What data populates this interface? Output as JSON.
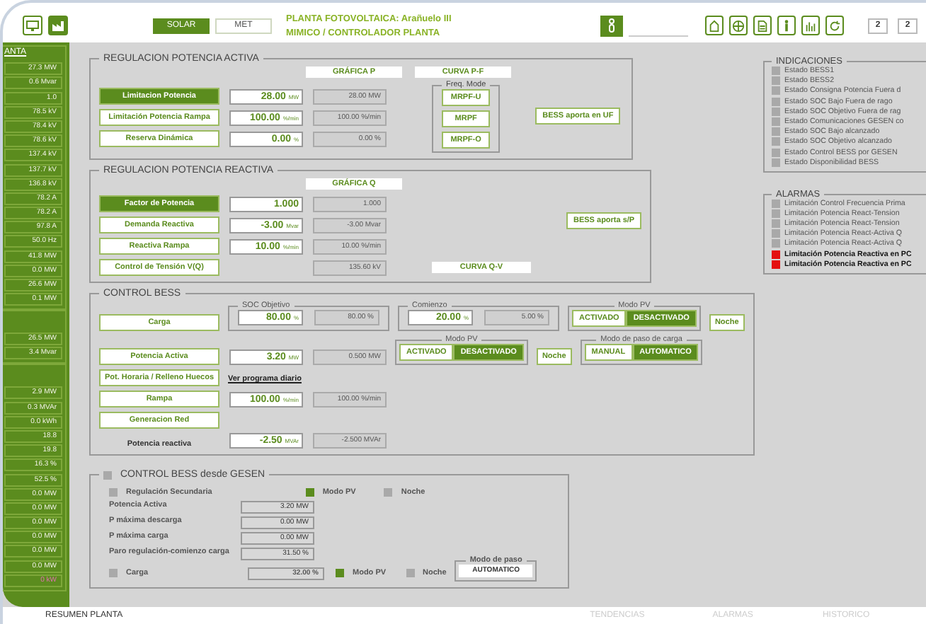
{
  "header": {
    "modes": [
      {
        "label": "SOLAR",
        "selected": true
      },
      {
        "label": "MET",
        "selected": false
      }
    ],
    "title": "PLANTA FOTOVOLTAICA:  Arañuelo III",
    "breadcrumb": "MIMICO / CONTROLADOR PLANTA",
    "counters": [
      "2",
      "2"
    ]
  },
  "sidebar": {
    "sections": [
      {
        "title": "ANTA",
        "items": [
          {
            "value": "27.3 MW",
            "alarm": false
          },
          {
            "value": "0.6 Mvar",
            "alarm": false
          },
          {
            "value": "1.0",
            "alarm": false
          },
          {
            "value": "78.5 kV",
            "alarm": false
          },
          {
            "value": "78.4 kV",
            "alarm": false
          },
          {
            "value": "78.6 kV",
            "alarm": false
          },
          {
            "value": "137.4 kV",
            "alarm": false
          },
          {
            "value": "137.7 kV",
            "alarm": false
          },
          {
            "value": "136.8 kV",
            "alarm": false
          },
          {
            "value": "78.2 A",
            "alarm": false
          },
          {
            "value": "78.2 A",
            "alarm": false
          },
          {
            "value": "97.8 A",
            "alarm": false
          },
          {
            "value": "50.0 Hz",
            "alarm": false
          },
          {
            "value": "41.8 MW",
            "alarm": false
          },
          {
            "value": "0.0 MW",
            "alarm": false
          },
          {
            "value": "26.6 MW",
            "alarm": false
          },
          {
            "value": "0.1 MW",
            "alarm": false
          }
        ]
      },
      {
        "items": [
          {
            "value": "26.5 MW",
            "alarm": false
          },
          {
            "value": "3.4 Mvar",
            "alarm": false
          }
        ]
      },
      {
        "items": [
          {
            "value": "2.9 MW",
            "alarm": false
          },
          {
            "value": "0.3 MVAr",
            "alarm": false
          },
          {
            "value": "0.0 kWh",
            "alarm": false
          },
          {
            "value": "18.8",
            "alarm": false
          },
          {
            "value": "19.8",
            "alarm": false
          },
          {
            "value": "16.3 %",
            "alarm": false
          },
          {
            "value": "52.5 %",
            "alarm": false
          },
          {
            "value": "0.0 MW",
            "alarm": false
          },
          {
            "value": "0.0 MW",
            "alarm": false
          },
          {
            "value": "0.0 MW",
            "alarm": false
          },
          {
            "value": "0.0 MW",
            "alarm": false
          },
          {
            "value": "0.0 MW",
            "alarm": false
          },
          {
            "value": "0.0 MW",
            "alarm": false
          },
          {
            "value": "0 kW",
            "alarm": true
          }
        ]
      }
    ]
  },
  "active_power": {
    "title": "REGULACION POTENCIA ACTIVA",
    "charts": [
      "GRÁFICA P",
      "CURVA P-F"
    ],
    "rows": [
      {
        "label": "Limitacion Potencia",
        "selected": true,
        "setpoint": "28.00",
        "unit": "MW",
        "actual": "28.00 MW"
      },
      {
        "label": "Limitación Potencia Rampa",
        "selected": false,
        "setpoint": "100.00",
        "unit": "%/min",
        "actual": "100.00 %/min"
      },
      {
        "label": "Reserva Dinámica",
        "selected": false,
        "setpoint": "0.00",
        "unit": "%",
        "actual": "0.00 %"
      }
    ],
    "freq_mode": {
      "title": "Freq. Mode",
      "buttons": [
        "MRPF-U",
        "MRPF",
        "MRPF-O"
      ]
    },
    "bess": "BESS aporta en UF"
  },
  "reactive_power": {
    "title": "REGULACION POTENCIA REACTIVA",
    "charts": [
      "GRÁFICA Q"
    ],
    "rows": [
      {
        "label": "Factor de Potencia",
        "selected": true,
        "setpoint": "1.000",
        "unit": "",
        "actual": "1.000"
      },
      {
        "label": "Demanda Reactiva",
        "selected": false,
        "setpoint": "-3.00",
        "unit": "Mvar",
        "actual": "-3.00 Mvar"
      },
      {
        "label": "Reactiva Rampa",
        "selected": false,
        "setpoint": "10.00",
        "unit": "%/min",
        "actual": "10.00 %/min"
      },
      {
        "label": "Control de Tensión V(Q)",
        "selected": false,
        "actual": "135.60 kV"
      }
    ],
    "bess": "BESS aporta s/P",
    "curve": "CURVA Q-V"
  },
  "control_bess": {
    "title": "CONTROL BESS",
    "lines": [
      [
        {
          "kind": "button",
          "label": "Carga",
          "selected": false
        },
        {
          "kind": "group",
          "title": "SOC Objetivo",
          "setpoint": "80.00",
          "unit": "%",
          "actual": "80.00 %"
        },
        {
          "kind": "group",
          "title": "Comienzo",
          "setpoint": "20.00",
          "unit": "%",
          "actual": "5.00 %"
        },
        {
          "kind": "toggle",
          "title": "Modo PV",
          "options": [
            {
              "label": "ACTIVADO",
              "selected": false
            },
            {
              "label": "DESACTIVADO",
              "selected": true
            }
          ]
        },
        {
          "kind": "button",
          "label": "Noche",
          "selected": false
        }
      ],
      [
        {
          "kind": "button",
          "label": "Potencia Activa",
          "selected": false
        },
        {
          "kind": "fields",
          "setpoint": "3.20",
          "unit": "MW",
          "actual": "0.500 MW"
        },
        {
          "kind": "toggle",
          "title": "Modo PV",
          "options": [
            {
              "label": "ACTIVADO",
              "selected": false
            },
            {
              "label": "DESACTIVADO",
              "selected": true
            }
          ]
        },
        {
          "kind": "button",
          "label": "Noche",
          "selected": false
        },
        {
          "kind": "toggle",
          "title": "Modo de paso de carga",
          "options": [
            {
              "label": "MANUAL",
              "selected": false
            },
            {
              "label": "AUTOMATICO",
              "selected": true
            }
          ]
        }
      ],
      [
        {
          "kind": "button",
          "label": "Pot. Horaria / Relleno Huecos",
          "selected": false
        },
        {
          "kind": "link",
          "label": "Ver programa diario"
        }
      ],
      [
        {
          "kind": "button",
          "label": "Rampa",
          "selected": false
        },
        {
          "kind": "fields",
          "setpoint": "100.00",
          "unit": "%/min",
          "actual": "100.00 %/min"
        }
      ],
      [
        {
          "kind": "button",
          "label": "Generacion Red",
          "selected": false
        }
      ],
      [
        {
          "kind": "label",
          "label": "Potencia reactiva"
        },
        {
          "kind": "fields",
          "setpoint": "-2.50",
          "unit": "MVAr",
          "actual": "-2.500 MVAr"
        }
      ]
    ]
  },
  "gesen": {
    "title": "CONTROL BESS desde GESEN",
    "on": false,
    "top": [
      {
        "label": "Regulación Secundaria",
        "on": false
      },
      {
        "label": "Modo PV",
        "on": true
      },
      {
        "label": "Noche",
        "on": false
      }
    ],
    "params": [
      {
        "label": "Potencia Activa",
        "value": "3.20 MW"
      },
      {
        "label": "P máxima descarga",
        "value": "0.00 MW"
      },
      {
        "label": "P máxima carga",
        "value": "0.00 MW"
      },
      {
        "label": "Paro regulación-comienzo carga",
        "value": "31.50 %"
      }
    ],
    "carga": {
      "label": "Carga",
      "on": false,
      "value": "32.00 %"
    },
    "bottom": [
      {
        "label": "Modo PV",
        "on": true
      },
      {
        "label": "Noche",
        "on": false
      }
    ],
    "modo_paso": {
      "title": "Modo de paso",
      "value": "AUTOMATICO"
    }
  },
  "indications": {
    "title": "INDICACIONES",
    "items": [
      {
        "label": "Estado BESS1",
        "on": false
      },
      {
        "label": "Estado BESS2",
        "on": false
      },
      {
        "label": "Estado Consigna Potencia Fuera d",
        "on": false
      },
      {
        "label": "Estado SOC Bajo Fuera de rago",
        "on": false
      },
      {
        "label": "Estado SOC Objetivo Fuera de rag",
        "on": false
      },
      {
        "label": "Estado Comunicaciones GESEN co",
        "on": false
      },
      {
        "label": "Estado SOC Bajo alcanzado",
        "on": false
      },
      {
        "label": "Estado SOC Objetivo alcanzado",
        "on": false
      },
      {
        "label": "Estado Control BESS por GESEN",
        "on": false
      },
      {
        "label": "Estado Disponibilidad BESS",
        "on": false
      }
    ]
  },
  "alarms": {
    "title": "ALARMAS",
    "items": [
      {
        "label": "Limitación Control Frecuencia Prima",
        "active": false
      },
      {
        "label": "Limitación Potencia React-Tension",
        "active": false
      },
      {
        "label": "Limitación Potencia React-Tension",
        "active": false
      },
      {
        "label": "Limitación Potencia React-Activa Q",
        "active": false
      },
      {
        "label": "Limitación Potencia React-Activa Q",
        "active": false
      },
      {
        "label": "Limitación Potencia Reactiva en PC",
        "active": true
      },
      {
        "label": "Limitación Potencia Reactiva en PC",
        "active": true
      }
    ]
  },
  "footer_tabs": [
    {
      "label": "RESUMEN PLANTA",
      "selected": true
    },
    {
      "label": "TENDENCIAS",
      "selected": false
    },
    {
      "label": "ALARMAS",
      "selected": false
    },
    {
      "label": "HISTORICO",
      "selected": false
    }
  ]
}
